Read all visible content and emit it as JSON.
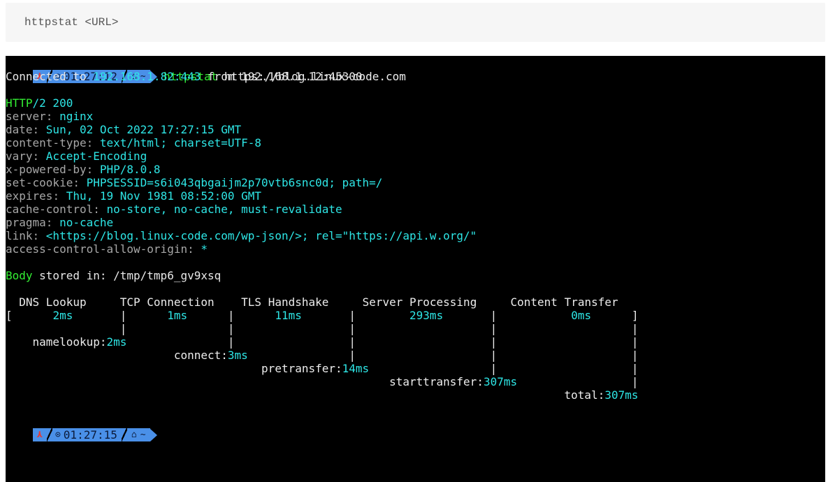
{
  "command_block": {
    "text": "httpstat <URL>"
  },
  "prompt1": {
    "status": "⋏",
    "clock_icon": "⊙",
    "time": "01:27:12",
    "home_icon": "⌂",
    "dir": "~",
    "cmd_name": "httpstat",
    "cmd_args": " https://blog.linux-code.com"
  },
  "connected": {
    "prefix": "Connected to ",
    "remote": "192.168.1.82:443",
    "middle": " from ",
    "local": "192.168.1.12:45300"
  },
  "status_line": {
    "proto": "HTTP",
    "rest": "/2 200"
  },
  "headers": [
    {
      "key": "server",
      "value": "nginx"
    },
    {
      "key": "date",
      "value": "Sun, 02 Oct 2022 17:27:15 GMT"
    },
    {
      "key": "content-type",
      "value": "text/html; charset=UTF-8"
    },
    {
      "key": "vary",
      "value": "Accept-Encoding"
    },
    {
      "key": "x-powered-by",
      "value": "PHP/8.0.8"
    },
    {
      "key": "set-cookie",
      "value": "PHPSESSID=s6i043qbgaijm2p70vtb6snc0d; path=/"
    },
    {
      "key": "expires",
      "value": "Thu, 19 Nov 1981 08:52:00 GMT"
    },
    {
      "key": "cache-control",
      "value": "no-store, no-cache, must-revalidate"
    },
    {
      "key": "pragma",
      "value": "no-cache"
    },
    {
      "key": "link",
      "value": "<https://blog.linux-code.com/wp-json/>; rel=\"https://api.w.org/\""
    },
    {
      "key": "access-control-allow-origin",
      "value": "*"
    }
  ],
  "body_stored": {
    "label": "Body",
    "rest": " stored in: /tmp/tmp6_gv9xsq"
  },
  "timing": {
    "columns": [
      "DNS Lookup",
      "TCP Connection",
      "TLS Handshake",
      "Server Processing",
      "Content Transfer"
    ],
    "durations": [
      "2ms",
      "1ms",
      "11ms",
      "293ms",
      "0ms"
    ],
    "open_bracket": "[",
    "close_bracket": "]",
    "pipe": "|",
    "cumulative": [
      {
        "label": "namelookup",
        "value": "2ms"
      },
      {
        "label": "connect",
        "value": "3ms"
      },
      {
        "label": "pretransfer",
        "value": "14ms"
      },
      {
        "label": "starttransfer",
        "value": "307ms"
      },
      {
        "label": "total",
        "value": "307ms"
      }
    ]
  },
  "prompt2": {
    "status": "⋏",
    "clock_icon": "⊙",
    "time": "01:27:15",
    "home_icon": "⌂",
    "dir": "~"
  },
  "colors": {
    "terminal_bg": "#000000",
    "cyan": "#2ee6e6",
    "green": "#33ee33",
    "gray": "#a7a7a7",
    "prompt_blue": "#4a90e8",
    "status_red": "#e53935",
    "code_box_bg": "#f6f6f6"
  }
}
